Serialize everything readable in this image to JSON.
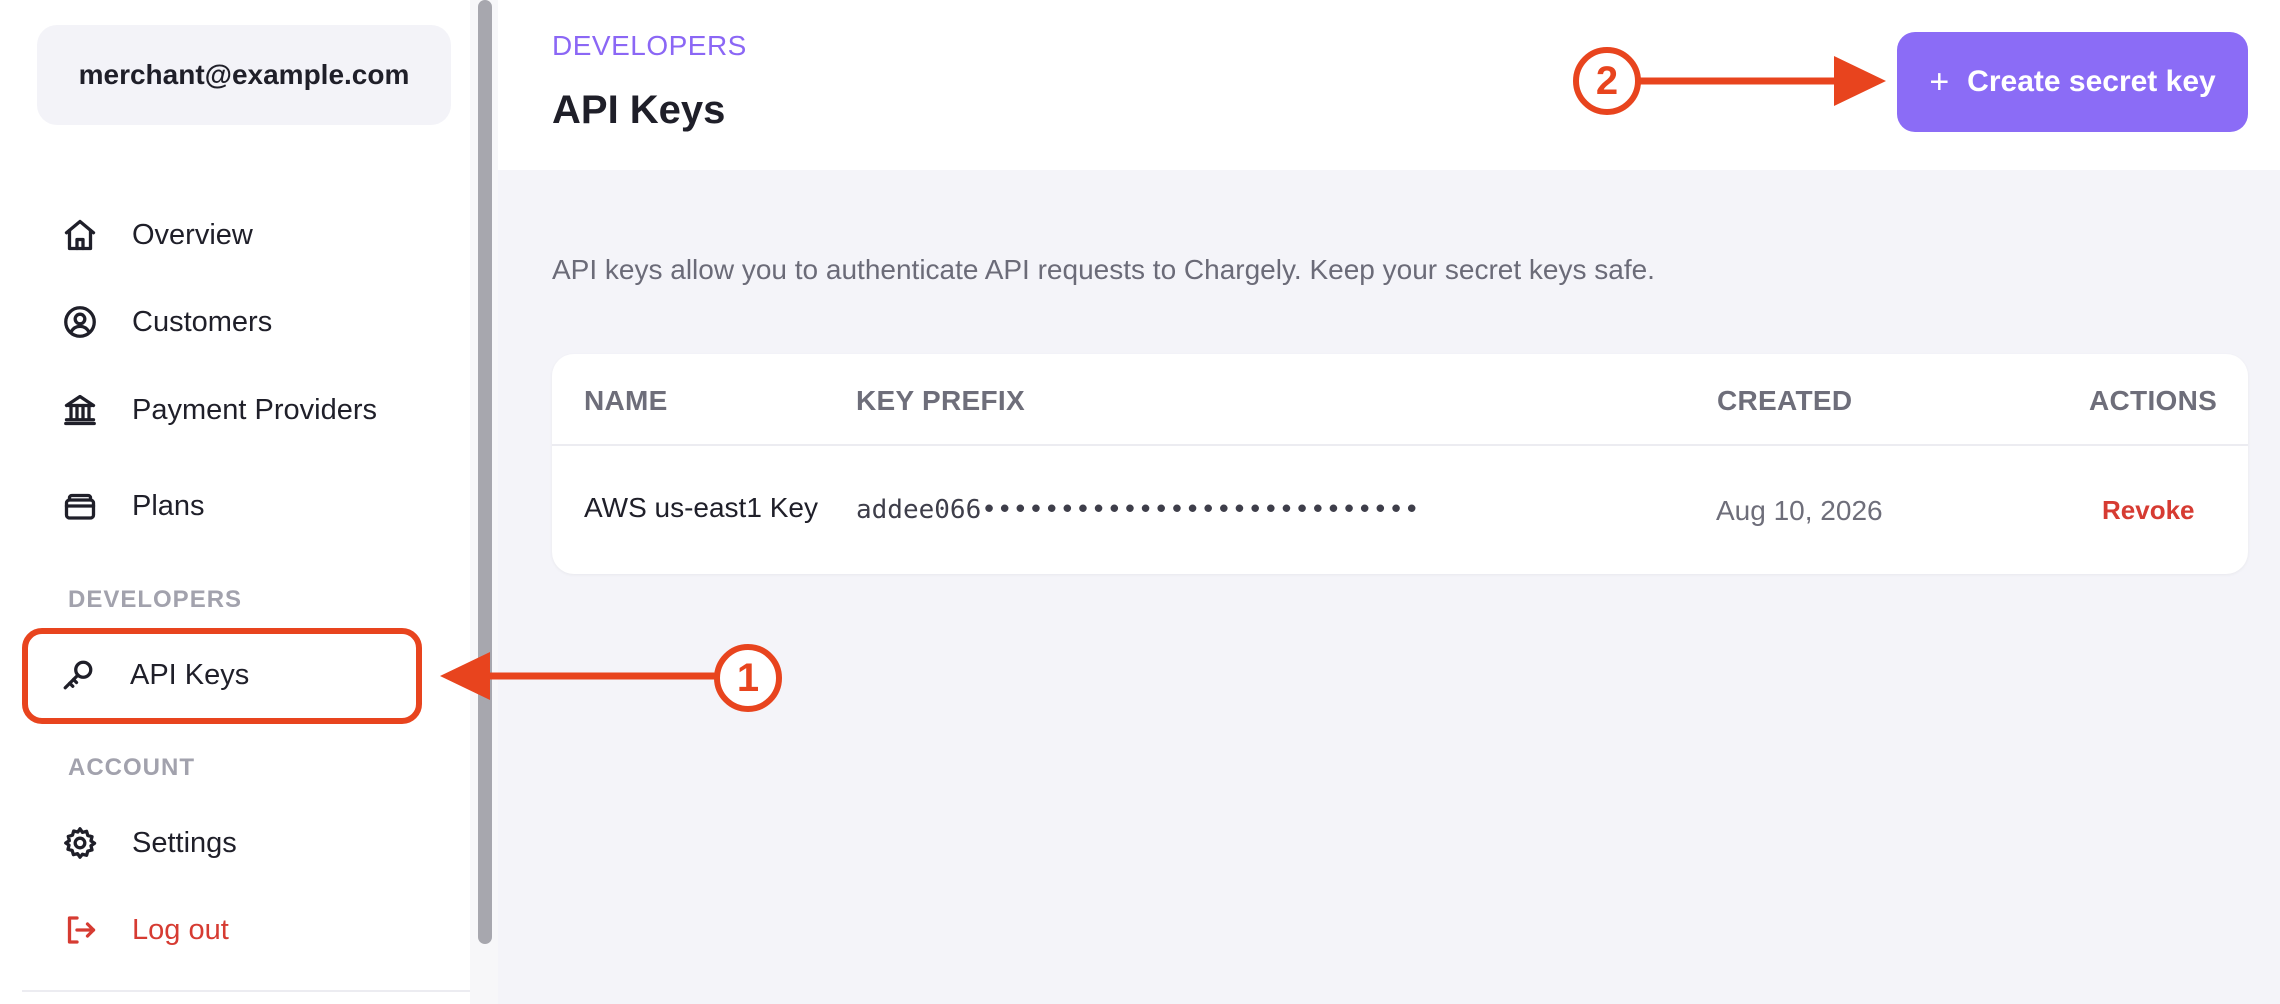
{
  "sidebar": {
    "account_email": "merchant@example.com",
    "items": [
      {
        "label": "Overview",
        "icon": "home-icon"
      },
      {
        "label": "Customers",
        "icon": "user-circle-icon"
      },
      {
        "label": "Payment Providers",
        "icon": "bank-icon"
      },
      {
        "label": "Plans",
        "icon": "wallet-icon"
      }
    ],
    "developers_label": "DEVELOPERS",
    "api_keys_label": "API Keys",
    "account_label": "ACCOUNT",
    "settings_label": "Settings",
    "logout_label": "Log out"
  },
  "header": {
    "eyebrow": "DEVELOPERS",
    "title": "API Keys",
    "create_button_label": "Create secret key"
  },
  "description": "API keys allow you to authenticate API requests to Chargely. Keep your secret keys safe.",
  "table": {
    "columns": [
      "NAME",
      "KEY PREFIX",
      "CREATED",
      "ACTIONS"
    ],
    "rows": [
      {
        "name": "AWS us-east1 Key",
        "key_prefix": "addee066••••••••••••••••••••••••••••",
        "created": "Aug 10, 2026",
        "action": "Revoke"
      }
    ]
  },
  "annotations": {
    "callout_1": "1",
    "callout_2": "2",
    "color": "#e8441e"
  },
  "colors": {
    "accent": "#8b6cf6",
    "danger": "#d63b32"
  }
}
